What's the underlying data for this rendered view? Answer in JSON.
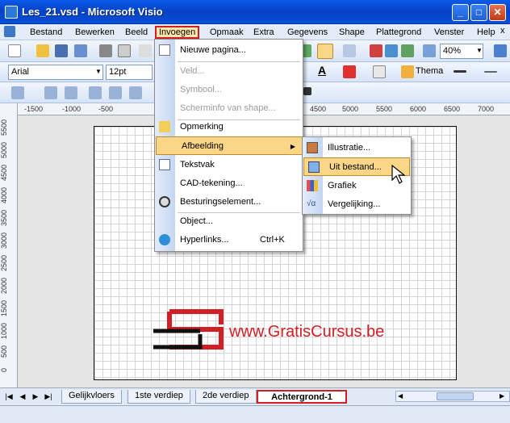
{
  "window": {
    "title": "Les_21.vsd - Microsoft Visio"
  },
  "menubar": {
    "items": [
      "Bestand",
      "Bewerken",
      "Beeld",
      "Invoegen",
      "Opmaak",
      "Extra",
      "Gegevens",
      "Shape",
      "Plattegrond",
      "Venster",
      "Help"
    ],
    "close_glyph": "x"
  },
  "toolbar": {
    "zoom": "40%",
    "font": "Arial",
    "size": "12pt",
    "thema_label": "Thema"
  },
  "ruler": {
    "top_ticks": [
      "-1500",
      "-1000",
      "-500",
      "4500",
      "5000",
      "5500",
      "6000",
      "6500",
      "7000"
    ],
    "left_ticks": [
      "5500",
      "5000",
      "4500",
      "4000",
      "3500",
      "3000",
      "2500",
      "2000",
      "1500",
      "1000",
      "500",
      "0"
    ]
  },
  "invoegen_menu": {
    "items": [
      {
        "label": "Nieuwe pagina...",
        "disabled": false
      },
      {
        "label": "Veld...",
        "disabled": true
      },
      {
        "label": "Symbool...",
        "disabled": true
      },
      {
        "label": "Scherminfo van shape...",
        "disabled": true
      },
      {
        "label": "Opmerking",
        "disabled": false
      },
      {
        "label": "Afbeelding",
        "disabled": false
      },
      {
        "label": "Tekstvak",
        "disabled": false
      },
      {
        "label": "CAD-tekening...",
        "disabled": false
      },
      {
        "label": "Besturingselement...",
        "disabled": false
      },
      {
        "label": "Object...",
        "disabled": false
      },
      {
        "label": "Hyperlinks...",
        "shortcut": "Ctrl+K",
        "disabled": false
      }
    ]
  },
  "afbeelding_submenu": {
    "items": [
      "Illustratie...",
      "Uit bestand...",
      "Grafiek",
      "Vergelijking..."
    ]
  },
  "page_tabs": [
    "Gelijkvloers",
    "1ste verdiep",
    "2de verdiep",
    "Achtergrond-1"
  ],
  "watermark": {
    "text": "www.GratisCursus.be"
  },
  "colors": {
    "accent_red": "#d21f25",
    "menu_highlight": "#fcd687",
    "title_blue": "#0542c6"
  }
}
